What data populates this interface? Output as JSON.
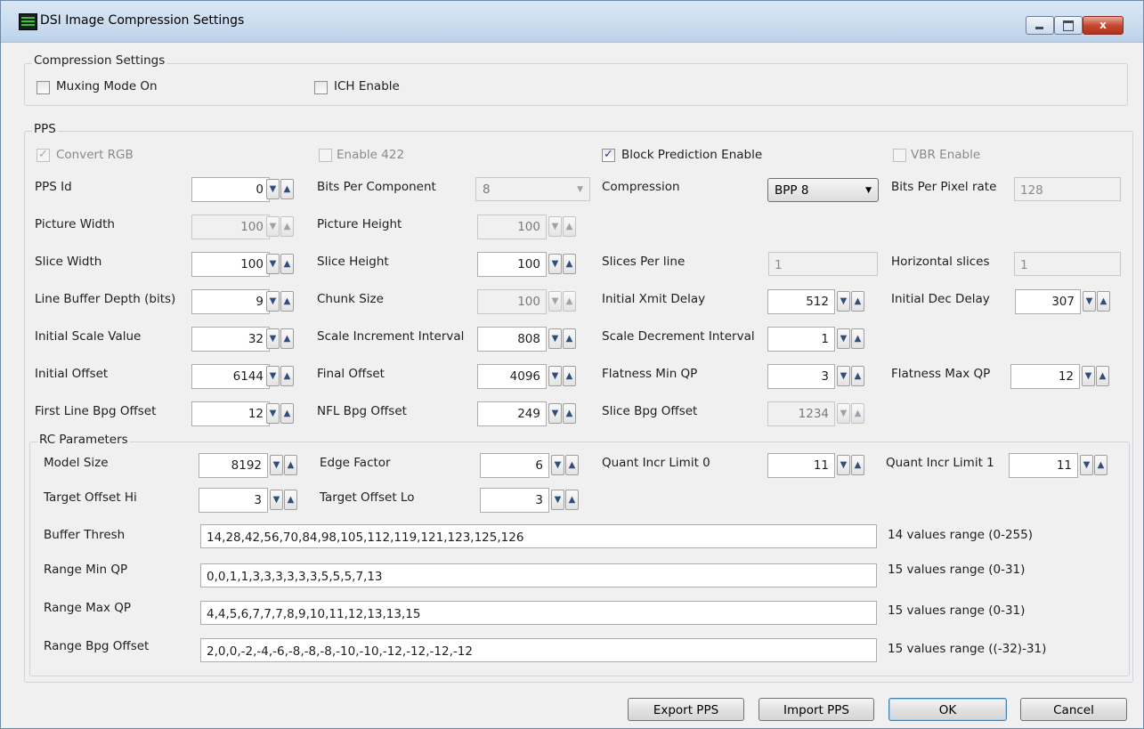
{
  "window": {
    "title": "DSI Image Compression Settings",
    "close_glyph": "x"
  },
  "compression": {
    "group_label": "Compression Settings",
    "muxing_label": "Muxing Mode On",
    "ich_label": "ICH Enable"
  },
  "pps": {
    "group_label": "PPS",
    "convert_rgb": "Convert RGB",
    "enable_422": "Enable 422",
    "block_pred": "Block Prediction Enable",
    "vbr": "VBR Enable",
    "pps_id": {
      "label": "PPS Id",
      "value": "0"
    },
    "bits_per_component": {
      "label": "Bits Per Component",
      "value": "8"
    },
    "compression": {
      "label": "Compression",
      "value": "BPP 8"
    },
    "bits_per_pixel_rate": {
      "label": "Bits Per Pixel rate",
      "value": "128"
    },
    "picture_width": {
      "label": "Picture Width",
      "value": "100"
    },
    "picture_height": {
      "label": "Picture Height",
      "value": "100"
    },
    "slice_width": {
      "label": "Slice Width",
      "value": "100"
    },
    "slice_height": {
      "label": "Slice Height",
      "value": "100"
    },
    "slices_per_line": {
      "label": "Slices Per line",
      "value": "1"
    },
    "horizontal_slices": {
      "label": "Horizontal slices",
      "value": "1"
    },
    "line_buffer_depth": {
      "label": "Line Buffer Depth (bits)",
      "value": "9"
    },
    "chunk_size": {
      "label": "Chunk Size",
      "value": "100"
    },
    "initial_xmit_delay": {
      "label": "Initial Xmit Delay",
      "value": "512"
    },
    "initial_dec_delay": {
      "label": "Initial Dec Delay",
      "value": "307"
    },
    "initial_scale_value": {
      "label": "Initial Scale Value",
      "value": "32"
    },
    "scale_increment_interval": {
      "label": "Scale Increment Interval",
      "value": "808"
    },
    "scale_decrement_interval": {
      "label": "Scale Decrement Interval",
      "value": "1"
    },
    "initial_offset": {
      "label": "Initial Offset",
      "value": "6144"
    },
    "final_offset": {
      "label": "Final Offset",
      "value": "4096"
    },
    "flatness_min_qp": {
      "label": "Flatness Min QP",
      "value": "3"
    },
    "flatness_max_qp": {
      "label": "Flatness Max QP",
      "value": "12"
    },
    "first_line_bpg_offset": {
      "label": "First Line Bpg Offset",
      "value": "12"
    },
    "nfl_bpg_offset": {
      "label": "NFL Bpg Offset",
      "value": "249"
    },
    "slice_bpg_offset": {
      "label": "Slice Bpg Offset",
      "value": "1234"
    }
  },
  "rc": {
    "group_label": "RC Parameters",
    "model_size": {
      "label": "Model Size",
      "value": "8192"
    },
    "edge_factor": {
      "label": "Edge Factor",
      "value": "6"
    },
    "quant_incr_limit0": {
      "label": "Quant Incr Limit 0",
      "value": "11"
    },
    "quant_incr_limit1": {
      "label": "Quant Incr Limit 1",
      "value": "11"
    },
    "target_offset_hi": {
      "label": "Target Offset Hi",
      "value": "3"
    },
    "target_offset_lo": {
      "label": "Target Offset Lo",
      "value": "3"
    },
    "buffer_thresh": {
      "label": "Buffer Thresh",
      "value": "14,28,42,56,70,84,98,105,112,119,121,123,125,126",
      "hint": "14 values range (0-255)"
    },
    "range_min_qp": {
      "label": "Range Min QP",
      "value": "0,0,1,1,3,3,3,3,3,3,5,5,5,7,13",
      "hint": "15 values range (0-31)"
    },
    "range_max_qp": {
      "label": "Range Max QP",
      "value": "4,4,5,6,7,7,7,8,9,10,11,12,13,13,15",
      "hint": "15 values range (0-31)"
    },
    "range_bpg_offset": {
      "label": "Range Bpg Offset",
      "value": "2,0,0,-2,-4,-6,-8,-8,-8,-10,-10,-12,-12,-12,-12",
      "hint": "15 values range ((-32)-31)"
    }
  },
  "buttons": {
    "export": "Export PPS",
    "import": "Import PPS",
    "ok": "OK",
    "cancel": "Cancel"
  },
  "glyphs": {
    "check": "✓",
    "down": "▼",
    "up": "▲"
  }
}
